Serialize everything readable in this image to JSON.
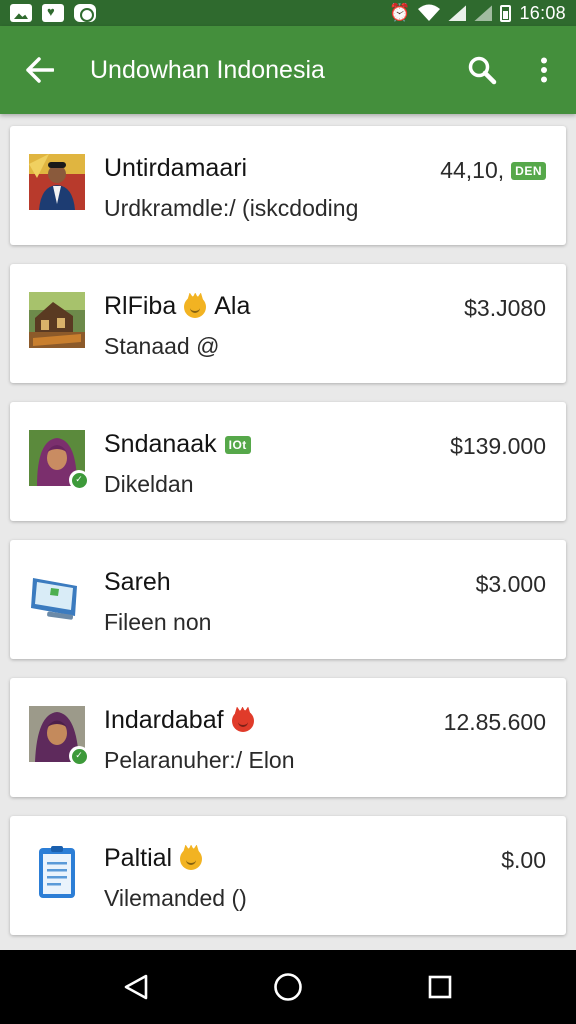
{
  "status_bar": {
    "time": "16:08",
    "left_icons": [
      "image-notification-icon",
      "shield-notification-icon",
      "app-notification-icon"
    ],
    "right_icons": [
      "alarm-icon",
      "wifi-icon",
      "signal-icon",
      "signal-icon",
      "battery-icon"
    ]
  },
  "app_bar": {
    "title": "Undowhan Indonesia",
    "background": "#448f3c",
    "status_background": "#2f6a2e"
  },
  "items": [
    {
      "name": "Untirdamaari",
      "subtitle": "Urdkramdle:/ (iskcdoding",
      "amount": "44,10,",
      "badge": "DEN",
      "avatar": "man-photo-avatar",
      "emoji": ""
    },
    {
      "name": "RlFiba",
      "subtitle": "Stanaad @",
      "amount": "$3.J080",
      "badge": "",
      "avatar": "house-photo-avatar",
      "emoji": "crown-emoji",
      "name_suffix": "Ala"
    },
    {
      "name": "Sndanaak",
      "subtitle": "Dikeldan",
      "amount": "$139.000",
      "badge": "IOt",
      "avatar": "woman-hijab-avatar",
      "emoji": ""
    },
    {
      "name": "Sareh",
      "subtitle": "Fileen non",
      "amount": "$3.000",
      "badge": "",
      "avatar": "monitor-icon",
      "emoji": ""
    },
    {
      "name": "Indardabaf",
      "subtitle": "Pelaranuher:/ Elon",
      "amount": "12.85.600",
      "badge": "",
      "avatar": "woman-hijab-avatar",
      "emoji": "red-crown-emoji"
    },
    {
      "name": "Paltial",
      "subtitle": "Vilemanded ()",
      "amount": "$.00",
      "badge": "",
      "avatar": "document-icon",
      "emoji": "crown-emoji"
    }
  ]
}
